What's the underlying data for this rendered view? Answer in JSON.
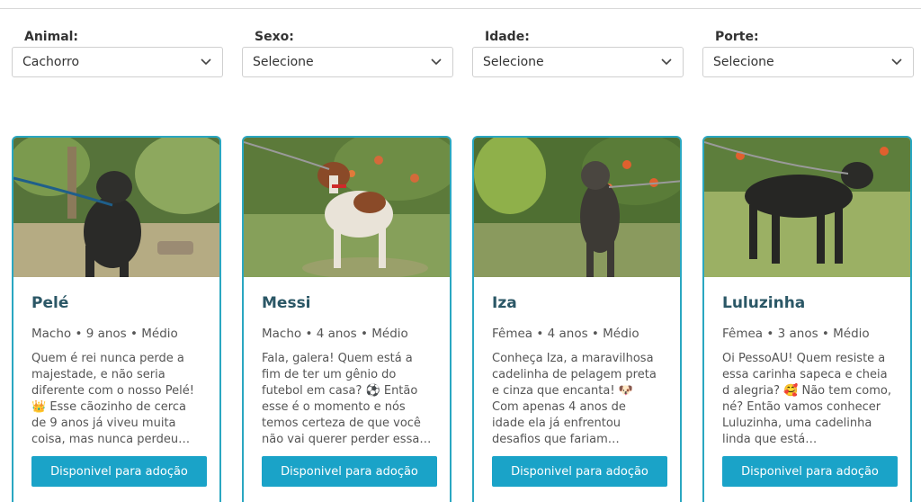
{
  "filters": [
    {
      "label": "Animal:",
      "value": "Cachorro"
    },
    {
      "label": "Sexo:",
      "value": "Selecione"
    },
    {
      "label": "Idade:",
      "value": "Selecione"
    },
    {
      "label": "Porte:",
      "value": "Selecione"
    }
  ],
  "pets": [
    {
      "name": "Pelé",
      "meta": "Macho • 9 anos • Médio",
      "description": "Quem é rei nunca perde a majestade, e não seria diferente com o nosso Pelé! 👑 Esse cãozinho de cerca de 9 anos já viveu muita coisa, mas nunca perdeu…",
      "button": "Disponivel para adoção"
    },
    {
      "name": "Messi",
      "meta": "Macho • 4 anos • Médio",
      "description": "Fala, galera! Quem está a fim de ter um gênio do futebol em casa? ⚽ Então esse é o momento e nós temos certeza de que você não vai querer perder essa…",
      "button": "Disponivel para adoção"
    },
    {
      "name": "Iza",
      "meta": "Fêmea • 4 anos • Médio",
      "description": "Conheça Iza, a maravilhosa cadelinha de pelagem preta e cinza que encanta! 🐶 Com apenas 4 anos de idade ela já enfrentou desafios que fariam…",
      "button": "Disponivel para adoção"
    },
    {
      "name": "Luluzinha",
      "meta": "Fêmea • 3 anos • Médio",
      "description": "Oi PessoAU! Quem resiste a essa carinha sapeca e cheia d alegria? 🥰 Não tem como, né? Então vamos conhecer Luluzinha, uma cadelinha linda que está…",
      "button": "Disponivel para adoção"
    }
  ],
  "colors": {
    "accent": "#1aa3c8",
    "card_border": "#2aa7c1",
    "name_text": "#2b5766"
  },
  "icons": {
    "select_arrow": "chevron-down-icon"
  }
}
